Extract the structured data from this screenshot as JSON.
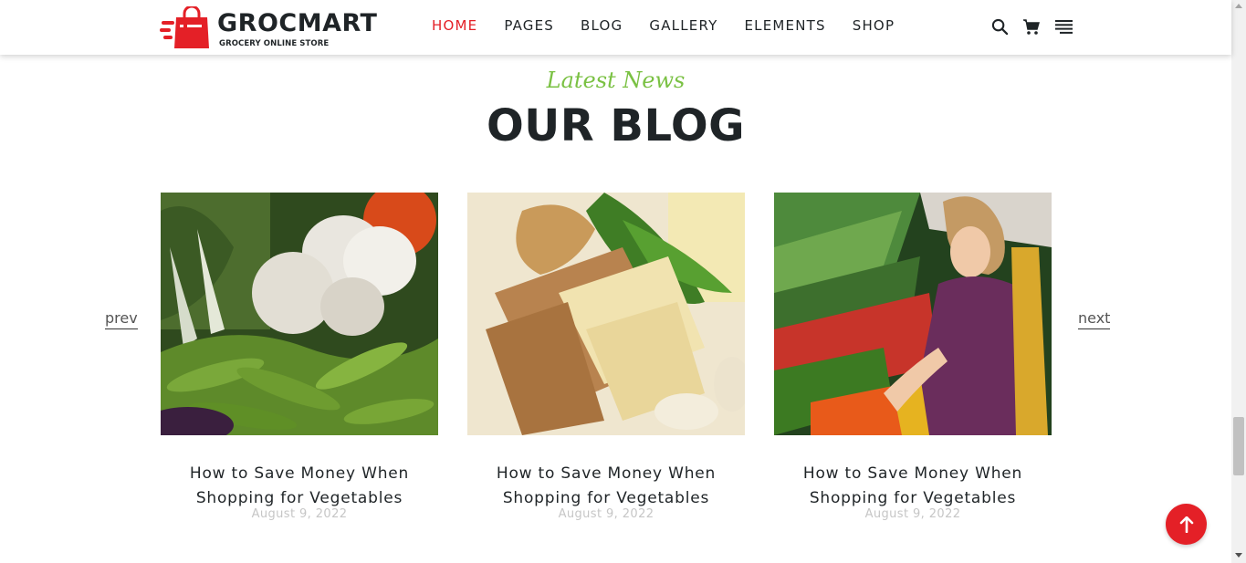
{
  "brand": {
    "name": "GROCMART",
    "tagline": "GROCERY ONLINE STORE",
    "accent_color": "#e42027"
  },
  "nav": {
    "items": [
      {
        "label": "HOME",
        "active": true
      },
      {
        "label": "PAGES",
        "active": false
      },
      {
        "label": "BLOG",
        "active": false
      },
      {
        "label": "GALLERY",
        "active": false
      },
      {
        "label": "ELEMENTS",
        "active": false
      },
      {
        "label": "SHOP",
        "active": false
      }
    ]
  },
  "header_icons": [
    "search-icon",
    "cart-icon",
    "menu-icon"
  ],
  "section": {
    "eyebrow": "Latest News",
    "title": "OUR BLOG",
    "eyebrow_color": "#7ac143"
  },
  "carousel": {
    "prev_label": "prev",
    "next_label": "next"
  },
  "posts": [
    {
      "title_line1": "How to Save Money When",
      "title_line2": "Shopping for Vegetables",
      "date": "August 9, 2022",
      "image": "vegetables-garlic-peas"
    },
    {
      "title_line1": "How to Save Money When",
      "title_line2": "Shopping for Vegetables",
      "date": "August 9, 2022",
      "image": "pasta-ginger-parsley"
    },
    {
      "title_line1": "How to Save Money When",
      "title_line2": "Shopping for Vegetables",
      "date": "August 9, 2022",
      "image": "woman-shopping-produce"
    }
  ],
  "back_to_top_icon": "arrow-up-icon"
}
